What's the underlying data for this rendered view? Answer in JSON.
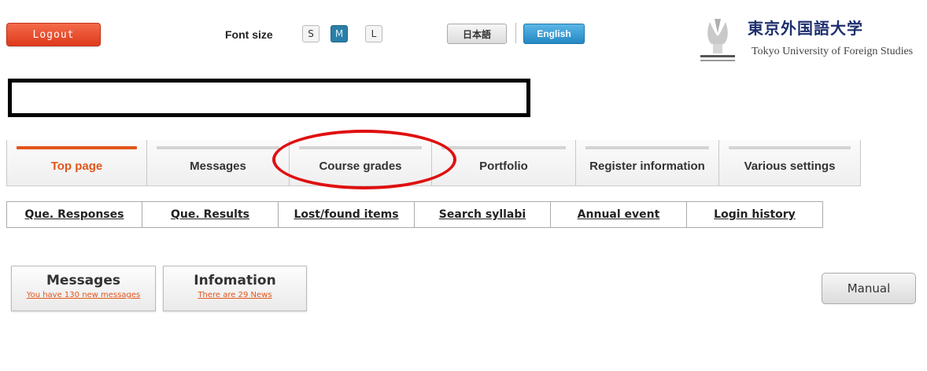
{
  "header": {
    "logout_label": "Logout",
    "font_size_label": "Font size",
    "font_sizes": [
      "S",
      "M",
      "L"
    ],
    "font_size_selected": "M",
    "lang_ja": "日本語",
    "lang_en": "English",
    "lang_selected": "English"
  },
  "logo": {
    "name_jp": "東京外国語大学",
    "name_en": "Tokyo University of Foreign Studies",
    "icon": "university-seal-icon"
  },
  "main_nav": {
    "tabs": [
      {
        "label": "Top page",
        "active": true
      },
      {
        "label": "Messages",
        "active": false
      },
      {
        "label": "Course grades",
        "active": false,
        "highlighted": true
      },
      {
        "label": "Portfolio",
        "active": false
      },
      {
        "label": "Register information",
        "active": false
      },
      {
        "label": "Various settings",
        "active": false
      }
    ]
  },
  "sub_nav": {
    "links": [
      "Que. Responses",
      "Que. Results",
      "Lost/found items",
      "Search syllabi",
      "Annual event",
      "Login history"
    ]
  },
  "cards": {
    "messages": {
      "title": "Messages",
      "subtitle": "You have  130 new messages"
    },
    "information": {
      "title": "Infomation",
      "subtitle": "There are 29 News"
    }
  },
  "manual_label": "Manual",
  "colors": {
    "accent": "#e2551b",
    "logout": "#dd3b1c",
    "english_button": "#2488c3",
    "highlight_circle": "#e01010"
  }
}
